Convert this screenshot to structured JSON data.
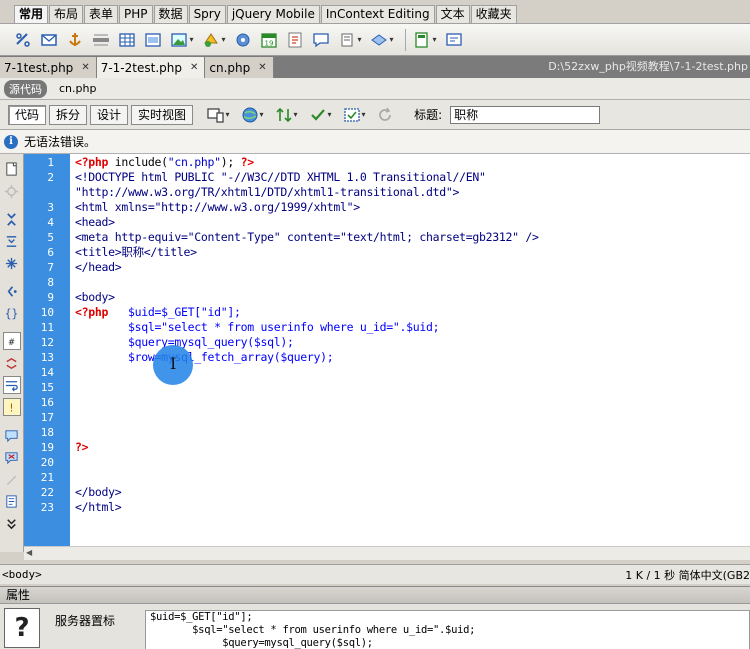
{
  "insert_tabs": [
    "常用",
    "布局",
    "表单",
    "PHP",
    "数据",
    "Spry",
    "jQuery Mobile",
    "InContext Editing",
    "文本",
    "收藏夹"
  ],
  "document_tabs": [
    {
      "label": "7-1test.php"
    },
    {
      "label": "7-1-2test.php"
    },
    {
      "label": "cn.php"
    }
  ],
  "document_path": "D:\\52zxw_php视频教程\\7-1-2test.php",
  "related_files": {
    "source_button": "源代码",
    "file": "cn.php"
  },
  "view_buttons": {
    "code": "代码",
    "split": "拆分",
    "design": "设计",
    "live": "实时视图"
  },
  "title_field": {
    "label": "标题:",
    "value": "职称"
  },
  "info_message": "无语法错误。",
  "line_numbers": [
    "1",
    "2",
    "",
    "3",
    "4",
    "5",
    "6",
    "7",
    "8",
    "9",
    "10",
    "11",
    "12",
    "13",
    "14",
    "15",
    "16",
    "17",
    "18",
    "19",
    "20",
    "21",
    "22",
    "23"
  ],
  "code": {
    "l1_open": "<?php",
    "l1_call": " include(",
    "l1_arg": "\"cn.php\"",
    "l1_end": ");",
    "l1_close": " ?>",
    "l2a": "<!DOCTYPE html PUBLIC \"-//W3C//DTD XHTML 1.0 Transitional//EN\"",
    "l2b": "\"http://www.w3.org/TR/xhtml1/DTD/xhtml1-transitional.dtd\">",
    "l3": "<html xmlns=\"http://www.w3.org/1999/xhtml\">",
    "l4": "<head>",
    "l5": "<meta http-equiv=\"Content-Type\" content=\"text/html; charset=gb2312\" />",
    "l6": "<title>职称</title>",
    "l7": "</head>",
    "l9": "<body>",
    "l10_php": "<?php",
    "l10_code": "   $uid=$_GET[\"id\"];",
    "l11": "        $sql=\"select * from userinfo where u_id=\".$uid;",
    "l12": "        $query=mysql_query($sql);",
    "l13": "        $row=mysql_fetch_array($query);",
    "l19": "?>",
    "l22": "</body>",
    "l23": "</html>"
  },
  "status": {
    "tag": "<body>",
    "right": "1 K / 1 秒  简体中文(GB2"
  },
  "properties": {
    "header": "属性",
    "label": "服务器置标",
    "code_lines": [
      "$uid=$_GET[\"id\"];",
      "       $sql=\"select * from userinfo where u_id=\".$uid;",
      "            $query=mysql_query($sql);"
    ]
  }
}
